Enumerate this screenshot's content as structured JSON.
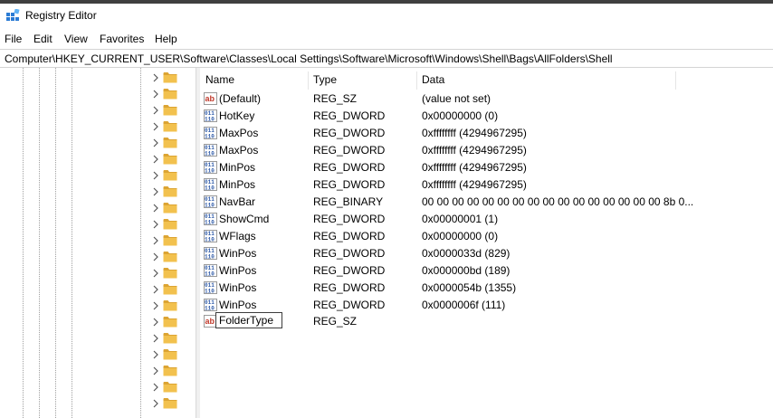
{
  "window": {
    "title": "Registry Editor"
  },
  "menu": [
    "File",
    "Edit",
    "View",
    "Favorites",
    "Help"
  ],
  "address": "Computer\\HKEY_CURRENT_USER\\Software\\Classes\\Local Settings\\Software\\Microsoft\\Windows\\Shell\\Bags\\AllFolders\\Shell",
  "columns": {
    "name": "Name",
    "type": "Type",
    "data": "Data"
  },
  "rows": [
    {
      "icon": "string-value-icon",
      "name": "(Default)",
      "type": "REG_SZ",
      "data": "(value not set)"
    },
    {
      "icon": "binary-value-icon",
      "name": "HotKey",
      "type": "REG_DWORD",
      "data": "0x00000000 (0)"
    },
    {
      "icon": "binary-value-icon",
      "name": "MaxPos",
      "type": "REG_DWORD",
      "data": "0xffffffff (4294967295)"
    },
    {
      "icon": "binary-value-icon",
      "name": "MaxPos",
      "type": "REG_DWORD",
      "data": "0xffffffff (4294967295)"
    },
    {
      "icon": "binary-value-icon",
      "name": "MinPos",
      "type": "REG_DWORD",
      "data": "0xffffffff (4294967295)"
    },
    {
      "icon": "binary-value-icon",
      "name": "MinPos",
      "type": "REG_DWORD",
      "data": "0xffffffff (4294967295)"
    },
    {
      "icon": "binary-value-icon",
      "name": "NavBar",
      "type": "REG_BINARY",
      "data": "00 00 00 00 00 00 00 00 00 00 00 00 00 00 00 00 8b 0..."
    },
    {
      "icon": "binary-value-icon",
      "name": "ShowCmd",
      "type": "REG_DWORD",
      "data": "0x00000001 (1)"
    },
    {
      "icon": "binary-value-icon",
      "name": "WFlags",
      "type": "REG_DWORD",
      "data": "0x00000000 (0)"
    },
    {
      "icon": "binary-value-icon",
      "name": "WinPos",
      "type": "REG_DWORD",
      "data": "0x0000033d (829)"
    },
    {
      "icon": "binary-value-icon",
      "name": "WinPos",
      "type": "REG_DWORD",
      "data": "0x000000bd (189)"
    },
    {
      "icon": "binary-value-icon",
      "name": "WinPos",
      "type": "REG_DWORD",
      "data": "0x0000054b (1355)"
    },
    {
      "icon": "binary-value-icon",
      "name": "WinPos",
      "type": "REG_DWORD",
      "data": "0x0000006f (111)"
    }
  ],
  "rename_row": {
    "icon": "string-value-icon",
    "name": "FolderType",
    "type": "REG_SZ"
  },
  "colors": {
    "folder": "#f2c14e",
    "folder_dark": "#dca433",
    "binary_icon": "#2e5aa8",
    "string_icon_text": "#c0392b"
  }
}
